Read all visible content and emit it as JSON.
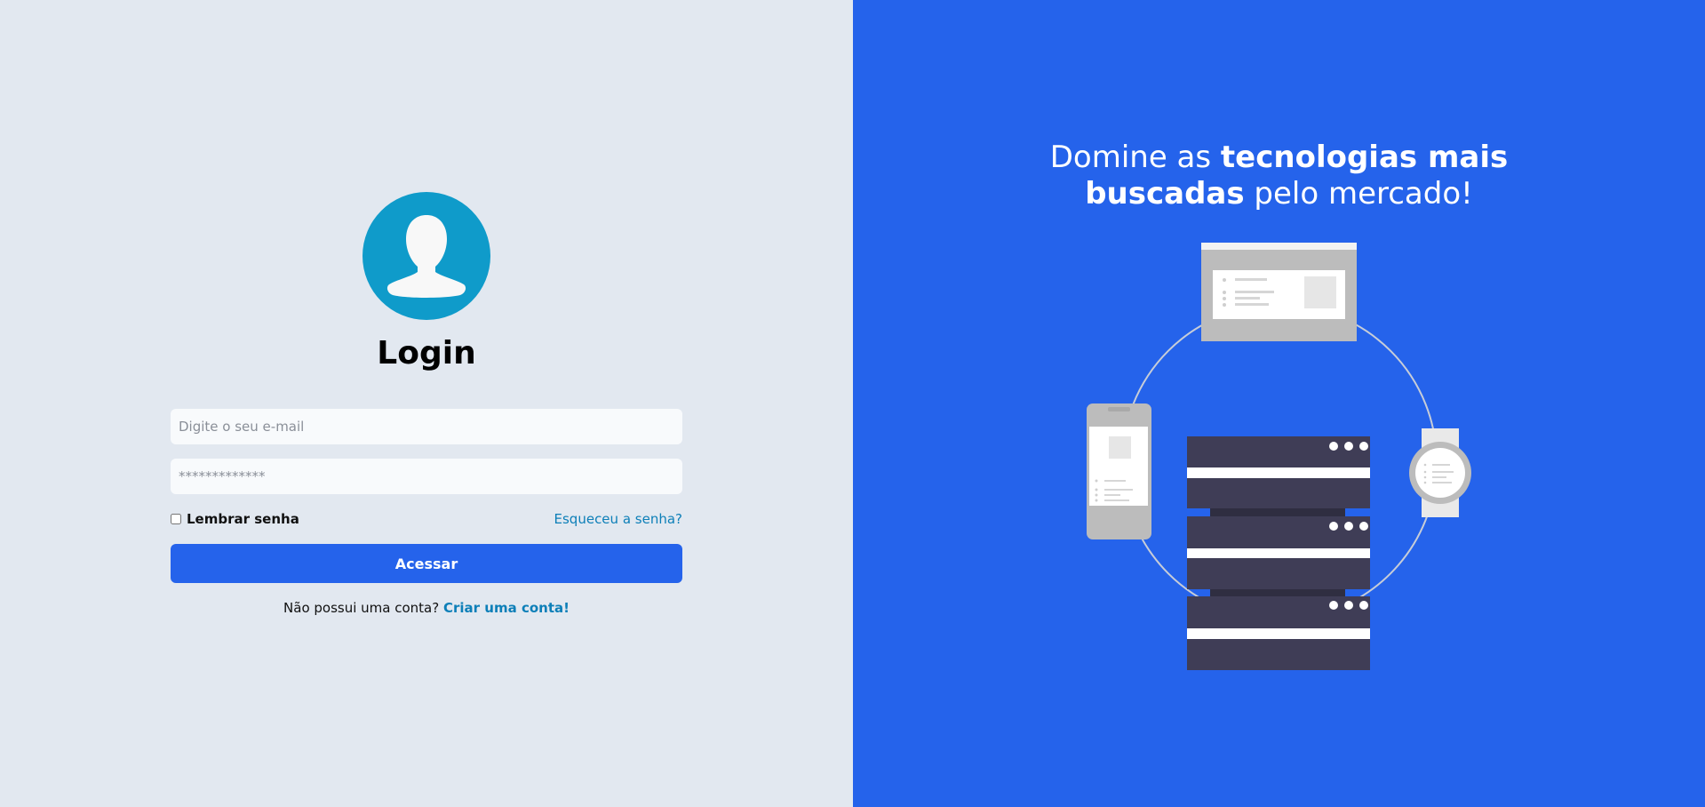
{
  "login": {
    "title": "Login",
    "email_placeholder": "Digite o seu e-mail",
    "password_placeholder": "*************",
    "remember_label": "Lembrar senha",
    "forgot_label": "Esqueceu a senha?",
    "submit_label": "Acessar",
    "signup_prompt": "Não possui uma conta?",
    "signup_link": "Criar uma conta!"
  },
  "promo": {
    "headline_part1": "Domine as ",
    "headline_bold1": "tecnologias mais",
    "headline_bold2": "buscadas",
    "headline_part2": " pelo mercado!"
  },
  "colors": {
    "left_bg": "#e2e8f0",
    "right_bg": "#2563eb",
    "avatar_bg": "#0f9bca",
    "button_bg": "#2563eb",
    "link": "#0d7fb8"
  },
  "icons": {
    "avatar": "user-silhouette-icon"
  }
}
